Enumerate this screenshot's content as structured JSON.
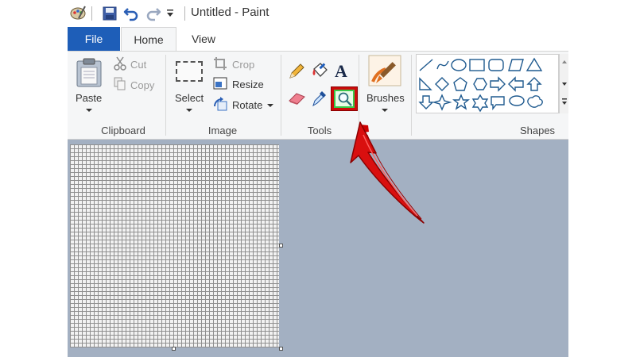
{
  "window": {
    "title": "Untitled - Paint"
  },
  "tabs": [
    {
      "label": "File"
    },
    {
      "label": "Home"
    },
    {
      "label": "View"
    }
  ],
  "clipboard": {
    "paste": "Paste",
    "cut": "Cut",
    "copy": "Copy",
    "group": "Clipboard"
  },
  "image": {
    "select": "Select",
    "crop": "Crop",
    "resize": "Resize",
    "rotate": "Rotate",
    "group": "Image"
  },
  "tools": {
    "group": "Tools",
    "highlighted_tool": "magnifier-icon"
  },
  "brushes": {
    "label": "Brushes"
  },
  "shapes": {
    "group": "Shapes"
  },
  "colors": {
    "accent_file_tab": "#1e5eb8",
    "highlight_green": "#3cc24a",
    "annotation_red": "#e01010",
    "workspace": "#a3b0c2"
  }
}
